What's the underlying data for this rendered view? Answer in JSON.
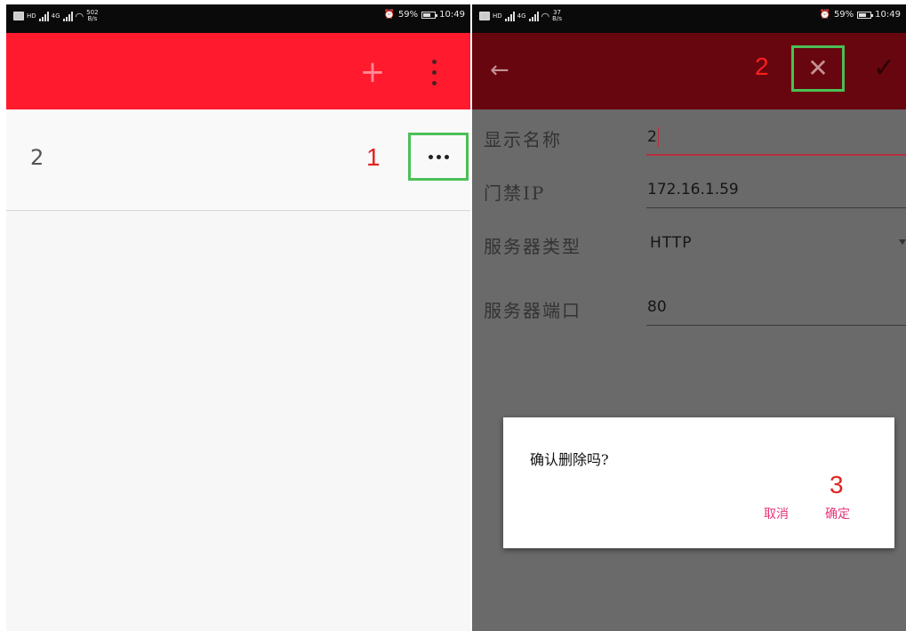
{
  "left_screen": {
    "status_bar": {
      "network_tag_1": "HD",
      "network_tag_2": "4G",
      "net_speed": "502\nB/s",
      "battery_pct": "59%",
      "time": "10:49"
    },
    "toolbar": {
      "add_icon": "plus-icon",
      "overflow_icon": "more-vertical-icon",
      "add_label": "+"
    },
    "list_item": {
      "name": "2",
      "step_marker": "1",
      "more_icon": "more-horizontal-icon"
    }
  },
  "right_screen": {
    "status_bar": {
      "network_tag_1": "HD",
      "network_tag_2": "4G",
      "net_speed": "37\nB/s",
      "battery_pct": "59%",
      "time": "10:49"
    },
    "toolbar": {
      "back_glyph": "←",
      "step_marker": "2",
      "delete_glyph": "✕",
      "confirm_glyph": "✓",
      "back_icon": "arrow-left-icon",
      "delete_icon": "close-icon",
      "confirm_icon": "check-icon"
    },
    "form": {
      "name_label": "显示名称",
      "name_value": "2",
      "ip_label": "门禁IP",
      "ip_value": "172.16.1.59",
      "server_type_label": "服务器类型",
      "server_type_value": "HTTP",
      "server_port_label": "服务器端口",
      "server_port_value": "80"
    },
    "dialog": {
      "message": "确认删除吗?",
      "step_marker": "3",
      "cancel_label": "取消",
      "ok_label": "确定"
    }
  },
  "colors": {
    "left_toolbar": "#ff1a2e",
    "right_toolbar": "#67060e",
    "highlight_box": "#4cbf56",
    "step_marker": "#e32222",
    "dialog_button": "#e8347a"
  }
}
